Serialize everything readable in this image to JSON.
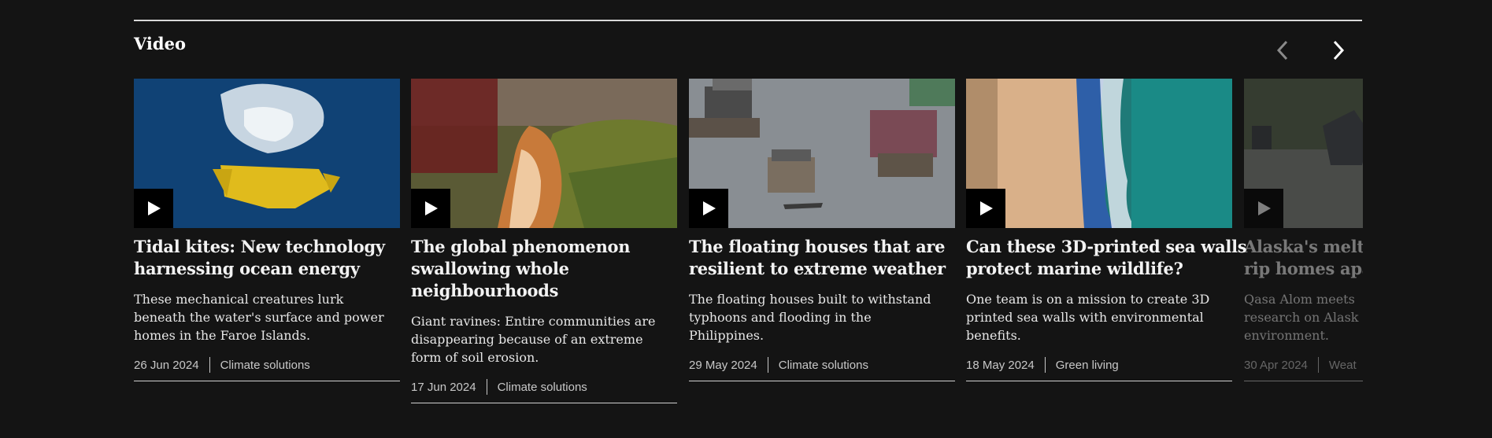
{
  "section": {
    "title": "Video"
  },
  "nav": {
    "prev_icon": "chevron-left-icon",
    "next_icon": "chevron-right-icon"
  },
  "cards": [
    {
      "headline_lines": [
        "Tidal kites: New technology",
        "harnessing ocean energy"
      ],
      "summary_lines": [
        "These mechanical creatures lurk",
        "beneath the water's surface and power",
        "homes in the Faroe Islands."
      ],
      "date": "26 Jun 2024",
      "category": "Climate solutions",
      "thumb_icon": "play-icon"
    },
    {
      "headline_lines": [
        "The global phenomenon",
        "swallowing whole",
        "neighbourhoods"
      ],
      "summary_lines": [
        "Giant ravines: Entire communities are",
        "disappearing because of an extreme",
        "form of soil erosion."
      ],
      "date": "17 Jun 2024",
      "category": "Climate solutions",
      "thumb_icon": "play-icon"
    },
    {
      "headline_lines": [
        "The floating houses that are",
        "resilient to extreme weather"
      ],
      "summary_lines": [
        "The floating houses built to withstand",
        "typhoons and flooding in the",
        "Philippines."
      ],
      "date": "29 May 2024",
      "category": "Climate solutions",
      "thumb_icon": "play-icon"
    },
    {
      "headline_lines": [
        "Can these 3D-printed sea walls",
        "protect marine wildlife?"
      ],
      "summary_lines": [
        "One team is on a mission to create 3D",
        "printed sea walls with environmental",
        "benefits."
      ],
      "date": "18 May 2024",
      "category": "Green living",
      "thumb_icon": "play-icon"
    },
    {
      "headline_lines": [
        "Alaska's melti",
        "rip homes apa"
      ],
      "summary_lines": [
        "Qasa Alom meets",
        "research on Alask",
        "environment."
      ],
      "date": "30 Apr 2024",
      "category": "Weat",
      "thumb_icon": "play-icon"
    }
  ],
  "colors": {
    "background": "#141414",
    "text": "#ffffff",
    "rule": "#d9d9d9"
  }
}
